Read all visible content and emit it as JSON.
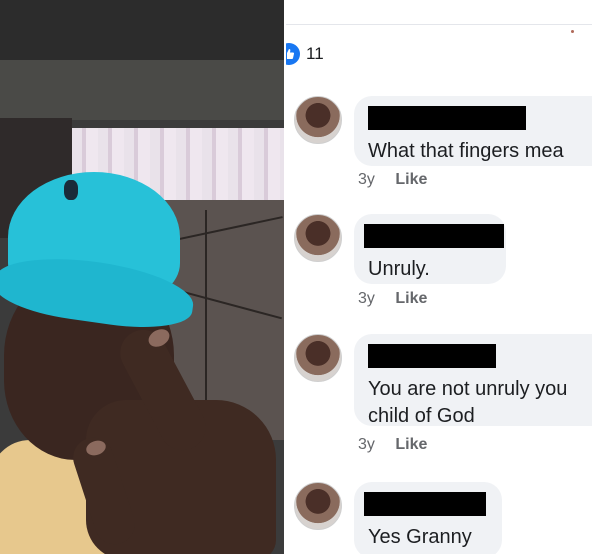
{
  "post": {
    "reaction_count": "11",
    "reaction_icon": "like-icon"
  },
  "comments": [
    {
      "text": "What that fingers mea",
      "time": "3y",
      "like_label": "Like"
    },
    {
      "text": "Unruly.",
      "time": "3y",
      "like_label": "Like"
    },
    {
      "text": "You are not unruly you\nchild of God",
      "time": "3y",
      "like_label": "Like"
    },
    {
      "text": "Yes Granny",
      "time": "",
      "like_label": ""
    }
  ],
  "colors": {
    "accent": "#1877f2",
    "bubble": "#f0f2f5",
    "meta_text": "#65676b",
    "redaction": "#000000"
  }
}
